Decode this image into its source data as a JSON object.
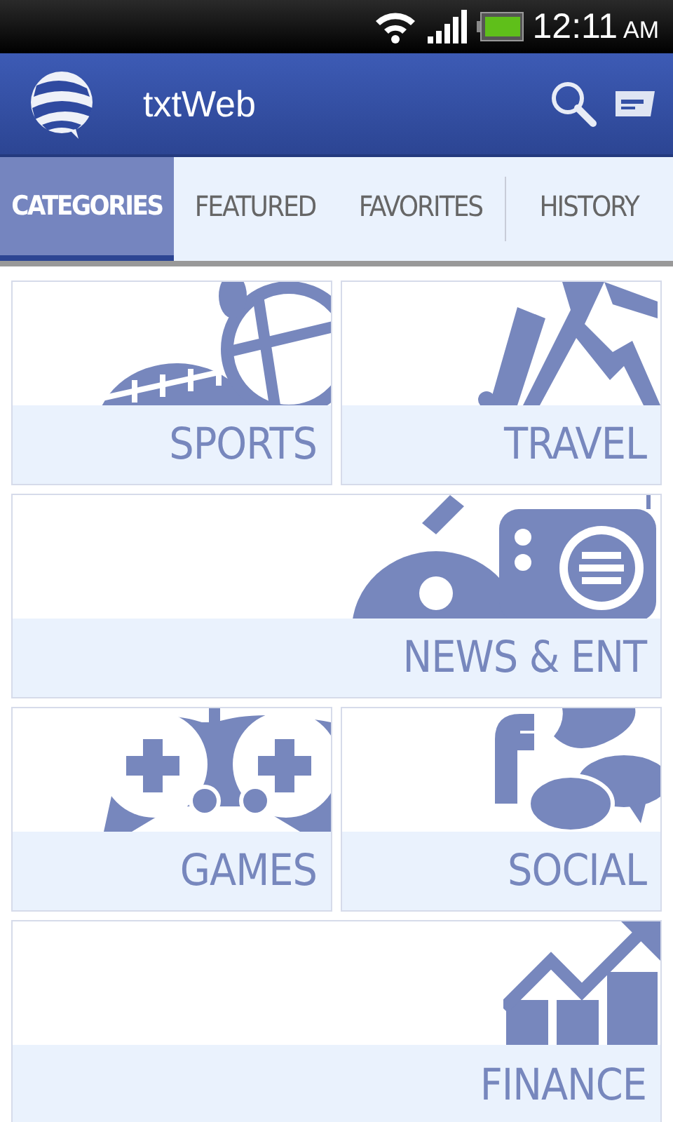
{
  "status_bar": {
    "time": "12:11",
    "meridiem": "AM"
  },
  "app_bar": {
    "title": "txtWeb"
  },
  "tabs": [
    {
      "label": "CATEGORIES",
      "selected": true
    },
    {
      "label": "FEATURED",
      "selected": false
    },
    {
      "label": "FAVORITES",
      "selected": false
    },
    {
      "label": "HISTORY",
      "selected": false
    }
  ],
  "categories": [
    {
      "label": "SPORTS",
      "kind": "sports",
      "wide": false
    },
    {
      "label": "TRAVEL",
      "kind": "travel",
      "wide": false
    },
    {
      "label": "NEWS & ENT",
      "kind": "news",
      "wide": true
    },
    {
      "label": "GAMES",
      "kind": "games",
      "wide": false
    },
    {
      "label": "SOCIAL",
      "kind": "social",
      "wide": false
    },
    {
      "label": "FINANCE",
      "kind": "finance",
      "wide": true
    }
  ]
}
